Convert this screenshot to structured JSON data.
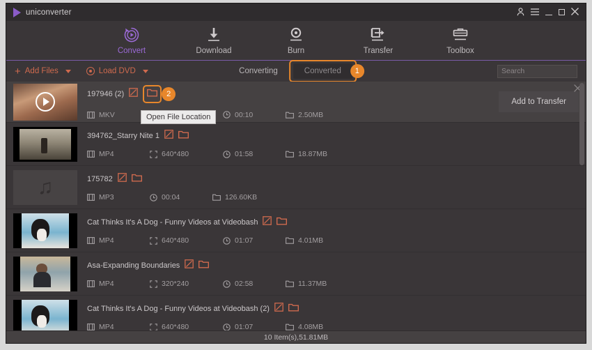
{
  "window": {
    "app_title": "uniconverter",
    "controls": [
      {
        "name": "account-icon",
        "glyph": "⚉"
      },
      {
        "name": "menu-icon",
        "glyph": "☰"
      },
      {
        "name": "minimize-icon",
        "glyph": "—"
      },
      {
        "name": "maximize-icon",
        "glyph": "□"
      },
      {
        "name": "close-icon",
        "glyph": "✕"
      }
    ]
  },
  "nav": {
    "active": "Convert",
    "accent": "#9b6ad6",
    "items": [
      {
        "label": "Convert",
        "icon": "convert-icon"
      },
      {
        "label": "Download",
        "icon": "download-icon"
      },
      {
        "label": "Burn",
        "icon": "burn-icon"
      },
      {
        "label": "Transfer",
        "icon": "transfer-icon"
      },
      {
        "label": "Toolbox",
        "icon": "toolbox-icon"
      }
    ]
  },
  "toolbar": {
    "add_files_label": "Add Files",
    "load_dvd_label": "Load DVD",
    "tabs": [
      {
        "label": "Converting",
        "selected": false
      },
      {
        "label": "Converted",
        "selected": true
      }
    ],
    "highlight_badge": "1",
    "accent_highlight": "#e8872b",
    "search_placeholder": "Search",
    "search_value": ""
  },
  "list": {
    "tooltip": "Open File Location",
    "first_row_badge": "2",
    "add_to_transfer_label": "Add to Transfer",
    "rows": [
      {
        "name": "197946 (2)",
        "format": "MKV",
        "resolution": "",
        "duration": "00:10",
        "size": "2.50MB",
        "thumb": "man-portrait",
        "selected": true
      },
      {
        "name": "394762_Starry Nite 1",
        "format": "MP4",
        "resolution": "640*480",
        "duration": "01:58",
        "size": "18.87MB",
        "thumb": "stage-scene",
        "selected": false
      },
      {
        "name": "175782",
        "format": "MP3",
        "resolution": "",
        "duration": "00:04",
        "size": "126.60KB",
        "thumb": "music-note",
        "selected": false
      },
      {
        "name": "Cat Thinks It's A Dog - Funny Videos at Videobash",
        "format": "MP4",
        "resolution": "640*480",
        "duration": "01:07",
        "size": "4.01MB",
        "thumb": "cat",
        "selected": false
      },
      {
        "name": "Asa-Expanding Boundaries",
        "format": "MP4",
        "resolution": "320*240",
        "duration": "02:58",
        "size": "11.37MB",
        "thumb": "man-blue",
        "selected": false
      },
      {
        "name": "Cat Thinks It's A Dog - Funny Videos at Videobash (2)",
        "format": "MP4",
        "resolution": "640*480",
        "duration": "01:07",
        "size": "4.08MB",
        "thumb": "cat",
        "selected": false
      }
    ]
  },
  "status": {
    "text": "10 Item(s),51.81MB"
  }
}
